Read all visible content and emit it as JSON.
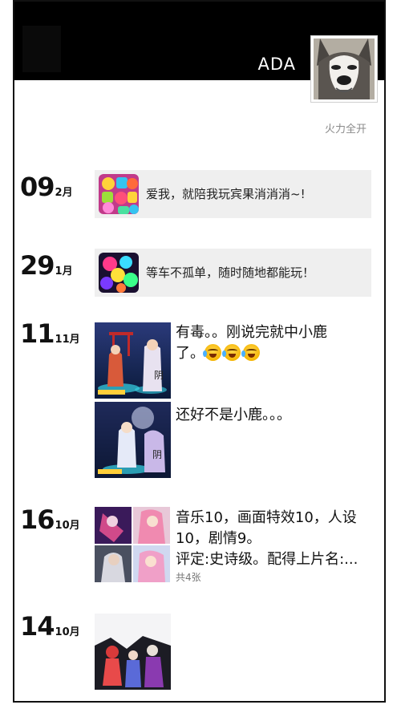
{
  "profile": {
    "username": "ADA",
    "signature": "火力全开",
    "avatar_icon": "husky-dog-avatar"
  },
  "posts": [
    {
      "day": "09",
      "month": "2月",
      "text": "爱我，就陪我玩宾果消消消~!",
      "thumb_icon": "candy-game-icon"
    },
    {
      "day": "29",
      "month": "1月",
      "text": "等车不孤单，随时随地都能玩！",
      "thumb_icon": "bubble-game-icon"
    },
    {
      "day": "11",
      "month": "11月",
      "text_line1": "有毒。。刚说完就中小鹿",
      "text_line2": "了。",
      "emoji_icon": "laughing-crying-emoji",
      "text2": "还好不是小鹿。。。"
    },
    {
      "day": "16",
      "month": "10月",
      "text_line1": "音乐10，画面特效10，人设",
      "text_line2": "10，剧情9。",
      "text_line3": "评定:史诗级。配得上片名:...",
      "count": "共4张"
    },
    {
      "day": "14",
      "month": "10月"
    }
  ]
}
